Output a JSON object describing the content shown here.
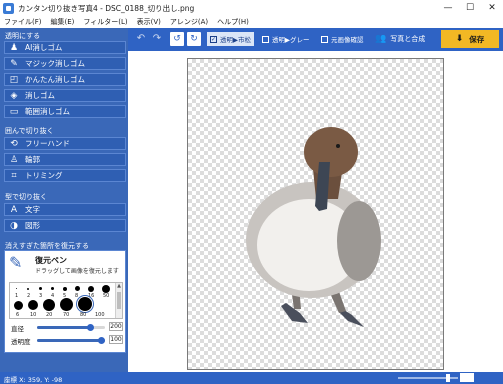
{
  "window": {
    "title": "カンタン切り抜き写真4 - DSC_0188_切り出し.png",
    "minimize": "—",
    "maximize": "☐",
    "close": "✕"
  },
  "menu": [
    "ファイル(F)",
    "編集(E)",
    "フィルター(L)",
    "表示(V)",
    "アレンジ(A)",
    "ヘルプ(H)"
  ],
  "sidebar": {
    "section_transparent": "透明にする",
    "transparent_tools": [
      {
        "label": "AI消しゴム",
        "icon": "ai-eraser-icon",
        "glyph": "♟"
      },
      {
        "label": "マジック消しゴム",
        "icon": "magic-wand-icon",
        "glyph": "✎"
      },
      {
        "label": "かんたん消しゴム",
        "icon": "easy-eraser-icon",
        "glyph": "◰"
      },
      {
        "label": "消しゴム",
        "icon": "eraser-icon",
        "glyph": "◈"
      },
      {
        "label": "範囲消しゴム",
        "icon": "range-eraser-icon",
        "glyph": "▭"
      }
    ],
    "section_enclose": "囲んで切り抜く",
    "enclose_tools": [
      {
        "label": "フリーハンド",
        "icon": "lasso-icon",
        "glyph": "⟲"
      },
      {
        "label": "輪郭",
        "icon": "contour-person-icon",
        "glyph": "♙"
      },
      {
        "label": "トリミング",
        "icon": "crop-icon",
        "glyph": "⌗"
      }
    ],
    "section_shape": "型で切り抜く",
    "shape_tools": [
      {
        "label": "文字",
        "icon": "text-icon",
        "glyph": "A"
      },
      {
        "label": "図形",
        "icon": "shapes-icon",
        "glyph": "◑"
      }
    ],
    "section_restore": "消えすぎた箇所を復元する",
    "restore": {
      "title": "復元ペン",
      "description": "ドラッグして画像を復元します",
      "brush_labels": [
        "1",
        "3",
        "5",
        "8",
        "16",
        "50",
        "2",
        "4",
        "6",
        "10",
        "20",
        "70",
        "80",
        "100"
      ],
      "diameter_label": "直径",
      "diameter_value": "200",
      "diameter_fraction": 0.8,
      "opacity_label": "透明度",
      "opacity_value": "100",
      "opacity_fraction": 1.0
    }
  },
  "toolbar": {
    "undo": "↶",
    "redo": "↷",
    "rotate_left": "↺",
    "rotate_right": "↻",
    "bg_checker": "透明▶市松",
    "bg_gray": "透明▶グレー",
    "bg_original": "元画像確認",
    "compose": "写真と合成",
    "save": "保存"
  },
  "status": {
    "coords": "座標 X: 359, Y: -98",
    "zoom_value": "",
    "zoom_fraction": 0.85
  },
  "colors": {
    "sidebar": "#3a68b8",
    "toolbar": "#2f63c4",
    "save": "#f2b824"
  }
}
